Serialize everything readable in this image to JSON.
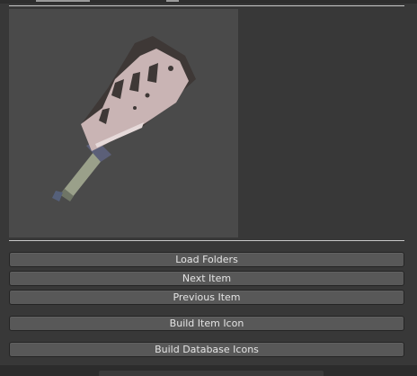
{
  "preview": {
    "icon": "cleaver-sword-icon",
    "background_color": "#4a4a4a"
  },
  "buttons": {
    "load_folders": "Load Folders",
    "next_item": "Next Item",
    "previous_item": "Previous Item",
    "build_item_icon": "Build Item Icon",
    "build_database_icons": "Build Database Icons"
  },
  "colors": {
    "panel_background": "#383838",
    "button_background": "#585858",
    "button_text": "#e4e4e4",
    "divider": "#c8c8c8"
  }
}
